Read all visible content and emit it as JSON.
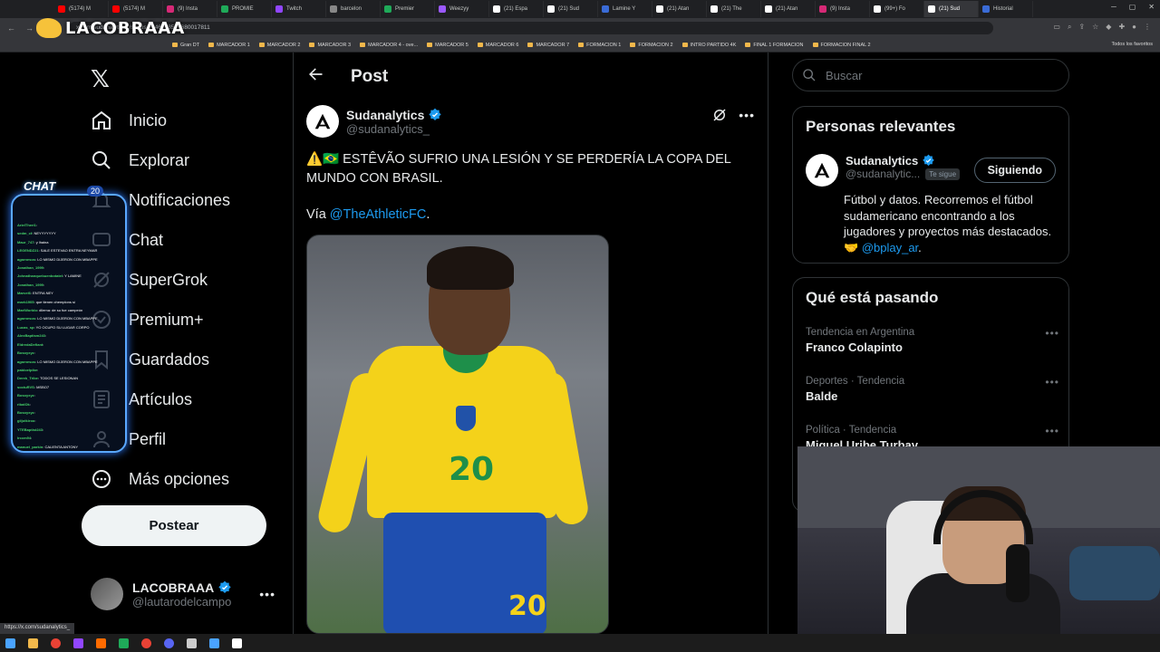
{
  "browser": {
    "tabs": [
      {
        "label": "(5174) M",
        "color": "#ff0000"
      },
      {
        "label": "(5174) M",
        "color": "#ff0000"
      },
      {
        "label": "(9) Insta",
        "color": "#d62976"
      },
      {
        "label": "PROMIE",
        "color": "#1faa59"
      },
      {
        "label": "Twitch",
        "color": "#9146ff"
      },
      {
        "label": "barcelon",
        "color": "#888888"
      },
      {
        "label": "Premier",
        "color": "#1faa59"
      },
      {
        "label": "Weezyy",
        "color": "#9b59ff"
      },
      {
        "label": "(21) Espa",
        "color": "#ffffff"
      },
      {
        "label": "(21) Sud",
        "color": "#ffffff"
      },
      {
        "label": "Lamine Y",
        "color": "#3a6bd6"
      },
      {
        "label": "(21) Atan",
        "color": "#ffffff"
      },
      {
        "label": "(21) The",
        "color": "#ffffff"
      },
      {
        "label": "(21) Atan",
        "color": "#ffffff"
      },
      {
        "label": "(9) Insta",
        "color": "#d62976"
      },
      {
        "label": "(99+) Fo",
        "color": "#ffffff"
      },
      {
        "label": "(21) Sud",
        "color": "#ffffff",
        "active": true
      },
      {
        "label": "Historial",
        "color": "#3a6bd6"
      }
    ],
    "url": "x.com/sudanalytics_/status/2046953589680017811",
    "bookmarks": [
      "Gran DT",
      "MARCADOR 1",
      "MARCADOR 2",
      "MARCADOR 3",
      "MARCADOR 4 - ove...",
      "MARCADOR 5",
      "MARCADOR 6",
      "MARCADOR 7",
      "FORMACION 1",
      "FORMACION 2",
      "INTRO PARTIDO 4K",
      "FINAL 1 FORMACION",
      "FORMACION FINAL 2"
    ],
    "bookmarks_right": "Todos los favoritos",
    "status_url": "https://x.com/sudanalytics_"
  },
  "overlay": {
    "brand": "LACOBRAAA",
    "chat_label": "CHAT",
    "chat_count": "20",
    "chat_lines": [
      {
        "user": "ArielTheri1",
        "msg": ""
      },
      {
        "user": "sedm_cf",
        "msg": "NEYYYYYYY"
      },
      {
        "user": "Maur_747",
        "msg": "y lhaina"
      },
      {
        "user": "LEGENDZ21",
        "msg": "SALE ESTEVAO ENTRA NEYMAR"
      },
      {
        "user": "agarnesos",
        "msg": "LO MISMO DIJERON CON MBAPPE"
      },
      {
        "user": "Jonathan_1999",
        "msg": ""
      },
      {
        "user": "Johnathanquebuenbotatel",
        "msg": "Y LAMINE"
      },
      {
        "user": "Jonathan_1999",
        "msg": ""
      },
      {
        "user": "Marvel6",
        "msg": "ENTRA NEY"
      },
      {
        "user": "mark1905",
        "msg": "que tienen chemplons sí"
      },
      {
        "user": "MariWorldo",
        "msg": "dilema: de su fue campeón"
      },
      {
        "user": "agarnesos",
        "msg": "LO MISMO DIJERON CON MBAPPE"
      },
      {
        "user": "Lucas_sp",
        "msg": "YO OCUPO SU LUGAR CORPO"
      },
      {
        "user": "AlexBaptism243",
        "msg": ""
      },
      {
        "user": "EldredaDefiant",
        "msg": ""
      },
      {
        "user": "Bosoyxyz",
        "msg": ""
      },
      {
        "user": "agarnesos",
        "msg": "LO MISMO DIJERON CON MBAPPE"
      },
      {
        "user": "pabloelpibe",
        "msg": ""
      },
      {
        "user": "Derek_Tribe",
        "msg": "TODOS SE LESIONAN"
      },
      {
        "user": "soctuRVS",
        "msg": "MSBO7"
      },
      {
        "user": "Bosoyxyz",
        "msg": ""
      },
      {
        "user": "ribalOk",
        "msg": ""
      },
      {
        "user": "Bosoyxyz",
        "msg": ""
      },
      {
        "user": "giijotkiroo",
        "msg": ""
      },
      {
        "user": "YTEBaptist243",
        "msg": ""
      },
      {
        "user": "lrccm94",
        "msg": ""
      },
      {
        "user": "manuel_parkin",
        "msg": "CALIENTA ANTONY"
      },
      {
        "user": "Bosoyxyz",
        "msg": ""
      },
      {
        "user": "pabloelpibe",
        "msg": ""
      },
      {
        "user": "pabloelpibe",
        "msg": ""
      }
    ]
  },
  "sidebar": {
    "items": [
      {
        "label": "Inicio",
        "icon": "home-icon"
      },
      {
        "label": "Explorar",
        "icon": "search-icon"
      },
      {
        "label": "Notificaciones",
        "icon": "bell-icon"
      },
      {
        "label": "Chat",
        "icon": "chat-icon"
      },
      {
        "label": "SuperGrok",
        "icon": "grok-icon"
      },
      {
        "label": "Premium+",
        "icon": "verified-icon"
      },
      {
        "label": "Guardados",
        "icon": "bookmark-icon"
      },
      {
        "label": "Artículos",
        "icon": "article-icon"
      },
      {
        "label": "Perfil",
        "icon": "profile-icon"
      },
      {
        "label": "Más opciones",
        "icon": "more-icon"
      }
    ],
    "post_button": "Postear",
    "account": {
      "name": "LACOBRAAA",
      "handle": "@lautarodelcampo"
    }
  },
  "main": {
    "header_title": "Post",
    "author_name": "Sudanalytics",
    "author_handle": "@sudanalytics_",
    "post_text": "⚠️🇧🇷 ESTÊVÃO SUFRIO UNA LESIÓN Y SE PERDERÍA LA COPA DEL MUNDO CON BRASIL.",
    "via_prefix": "Vía ",
    "via_link": "@TheAthleticFC",
    "via_suffix": ".",
    "media_shirt_number": "20"
  },
  "right": {
    "search_placeholder": "Buscar",
    "relevant": {
      "title": "Personas relevantes",
      "name": "Sudanalytics",
      "handle": "@sudanalytic...",
      "tag": "Te sigue",
      "button": "Siguiendo",
      "bio": "Fútbol y datos. Recorremos el fútbol sudamericano encontrando a los jugadores y proyectos más destacados. 🤝 ",
      "bio_link": "@bplay_ar",
      "bio_suffix": "."
    },
    "trends_title": "Qué está pasando",
    "trends": [
      {
        "category": "Tendencia en Argentina",
        "title": "Franco Colapinto"
      },
      {
        "category": "Deportes · Tendencia",
        "title": "Balde"
      },
      {
        "category": "Política · Tendencia",
        "title": "Miguel Uribe Turbay"
      }
    ]
  },
  "colors": {
    "accent": "#1d9bf0",
    "background": "#000000",
    "border": "#2f3336",
    "verified": "#1d9bf0"
  }
}
